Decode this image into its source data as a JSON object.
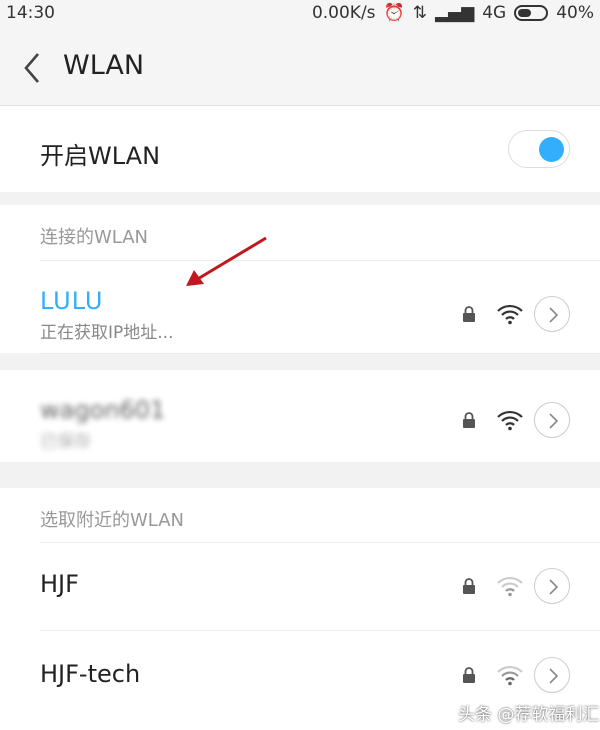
{
  "status_bar": {
    "time": "14:30",
    "speed": "0.00K/s",
    "network": "4G",
    "battery": "40%"
  },
  "header": {
    "title": "WLAN"
  },
  "wlan_toggle": {
    "label": "开启WLAN",
    "enabled": true
  },
  "connected_section": {
    "header": "连接的WLAN",
    "networks": [
      {
        "name": "LULU",
        "status": "正在获取IP地址...",
        "secured": true
      },
      {
        "name": "wagon601",
        "status": "已保存",
        "secured": true
      }
    ]
  },
  "nearby_section": {
    "header": "选取附近的WLAN",
    "networks": [
      {
        "name": "HJF",
        "secured": true
      },
      {
        "name": "HJF-tech",
        "secured": true
      }
    ]
  },
  "watermark": "头条 @荐软福利汇",
  "colors": {
    "accent": "#33aefc",
    "arrow": "#c0181e"
  }
}
